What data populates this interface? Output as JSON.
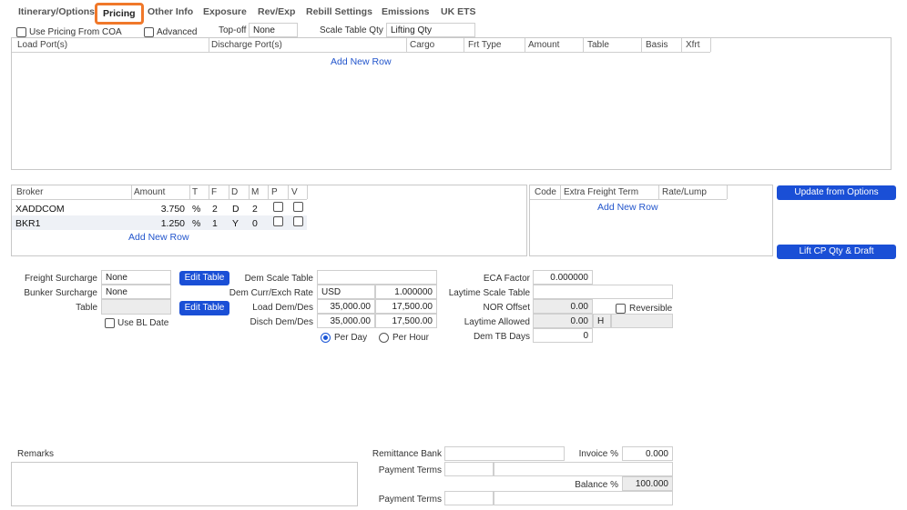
{
  "tabs": [
    "Itinerary/Options",
    "Pricing",
    "Other Info",
    "Exposure",
    "Rev/Exp",
    "Rebill Settings",
    "Emissions",
    "UK ETS"
  ],
  "top_options": {
    "use_pricing_coa": "Use Pricing From COA",
    "advanced": "Advanced",
    "topoff_label": "Top-off",
    "topoff_value": "None",
    "scale_table_qty_label": "Scale Table Qty",
    "scale_table_qty_value": "Lifting Qty"
  },
  "cargo_grid": {
    "headers": [
      "Load Port(s)",
      "Discharge Port(s)",
      "Cargo",
      "Frt Type",
      "Amount",
      "Table",
      "Basis",
      "Xfrt"
    ],
    "add_row": "Add New Row"
  },
  "broker_grid": {
    "headers": [
      "Broker",
      "Amount",
      "T",
      "F",
      "D",
      "M",
      "P",
      "V"
    ],
    "rows": [
      {
        "broker": "XADDCOM",
        "amount": "3.750",
        "t": "%",
        "f": "2",
        "d": "D",
        "m": "2"
      },
      {
        "broker": "BKR1",
        "amount": "1.250",
        "t": "%",
        "f": "1",
        "d": "Y",
        "m": "0"
      }
    ],
    "add_row": "Add New Row"
  },
  "extra_freight_grid": {
    "headers": [
      "Code",
      "Extra Freight Term",
      "Rate/Lump"
    ],
    "add_row": "Add New Row"
  },
  "buttons": {
    "update_from_options": "Update from Options",
    "lift_cp_qty": "Lift CP Qty & Draft",
    "edit_table": "Edit Table"
  },
  "surcharges": {
    "freight_label": "Freight Surcharge",
    "freight_value": "None",
    "bunker_label": "Bunker Surcharge",
    "bunker_value": "None",
    "table_label": "Table",
    "use_bl_date": "Use BL Date"
  },
  "demurrage": {
    "scale_table_label": "Dem Scale Table",
    "scale_table_value": "",
    "curr_label": "Dem Curr/Exch Rate",
    "currency": "USD",
    "exch_rate": "1.000000",
    "load_label": "Load Dem/Des",
    "load_dem": "35,000.00",
    "load_des": "17,500.00",
    "disch_label": "Disch Dem/Des",
    "disch_dem": "35,000.00",
    "disch_des": "17,500.00",
    "per_day": "Per Day",
    "per_hour": "Per Hour"
  },
  "laytime": {
    "eca_label": "ECA Factor",
    "eca_value": "0.000000",
    "scale_label": "Laytime Scale Table",
    "scale_value": "",
    "nor_label": "NOR Offset",
    "nor_value": "0.00",
    "reversible": "Reversible",
    "allowed_label": "Laytime Allowed",
    "allowed_value": "0.00",
    "allowed_unit": "H",
    "dem_tb_label": "Dem TB Days",
    "dem_tb_value": "0"
  },
  "remarks": {
    "label": "Remarks"
  },
  "remittance": {
    "bank_label": "Remittance Bank",
    "invoice_label": "Invoice %",
    "invoice_value": "0.000",
    "payment_terms_label": "Payment Terms",
    "balance_label": "Balance %",
    "balance_value": "100.000",
    "payment_terms_label_2": "Payment Terms"
  }
}
